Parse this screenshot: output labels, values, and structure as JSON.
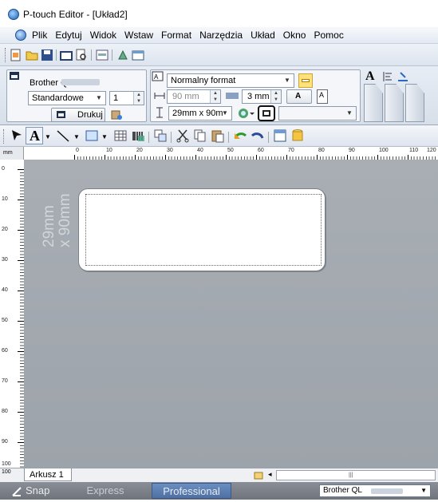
{
  "window": {
    "title": "P-touch Editor - [Układ2]"
  },
  "menu": {
    "items": [
      "Plik",
      "Edytuj",
      "Widok",
      "Wstaw",
      "Format",
      "Narzędzia",
      "Układ",
      "Okno",
      "Pomoc"
    ]
  },
  "printer_panel": {
    "printer_name": "Brother QL",
    "print_mode": "Standardowe",
    "copies": "1",
    "print_label": "Drukuj"
  },
  "format_panel": {
    "paper_format": "Normalny format",
    "length": "90 mm",
    "margin": "3 mm",
    "tape_size": "29mm x 90m"
  },
  "ruler": {
    "unit": "mm",
    "h_labels": [
      "0",
      "10",
      "20",
      "30",
      "40",
      "50",
      "60",
      "70",
      "80",
      "90",
      "100",
      "110",
      "120"
    ],
    "v_labels": [
      "0",
      "10",
      "20",
      "30",
      "40",
      "50",
      "60",
      "70",
      "80",
      "90",
      "100"
    ]
  },
  "canvas": {
    "size_label_line1": "29mm",
    "size_label_line2": "x 90mm"
  },
  "sheets": {
    "tab": "Arkusz 1"
  },
  "modes": {
    "snap": "Snap",
    "express": "Express",
    "professional": "Professional"
  },
  "status_printer": "Brother QL",
  "colors": {
    "canvas": "#a3a9af",
    "mode_active": "#5577aa"
  }
}
